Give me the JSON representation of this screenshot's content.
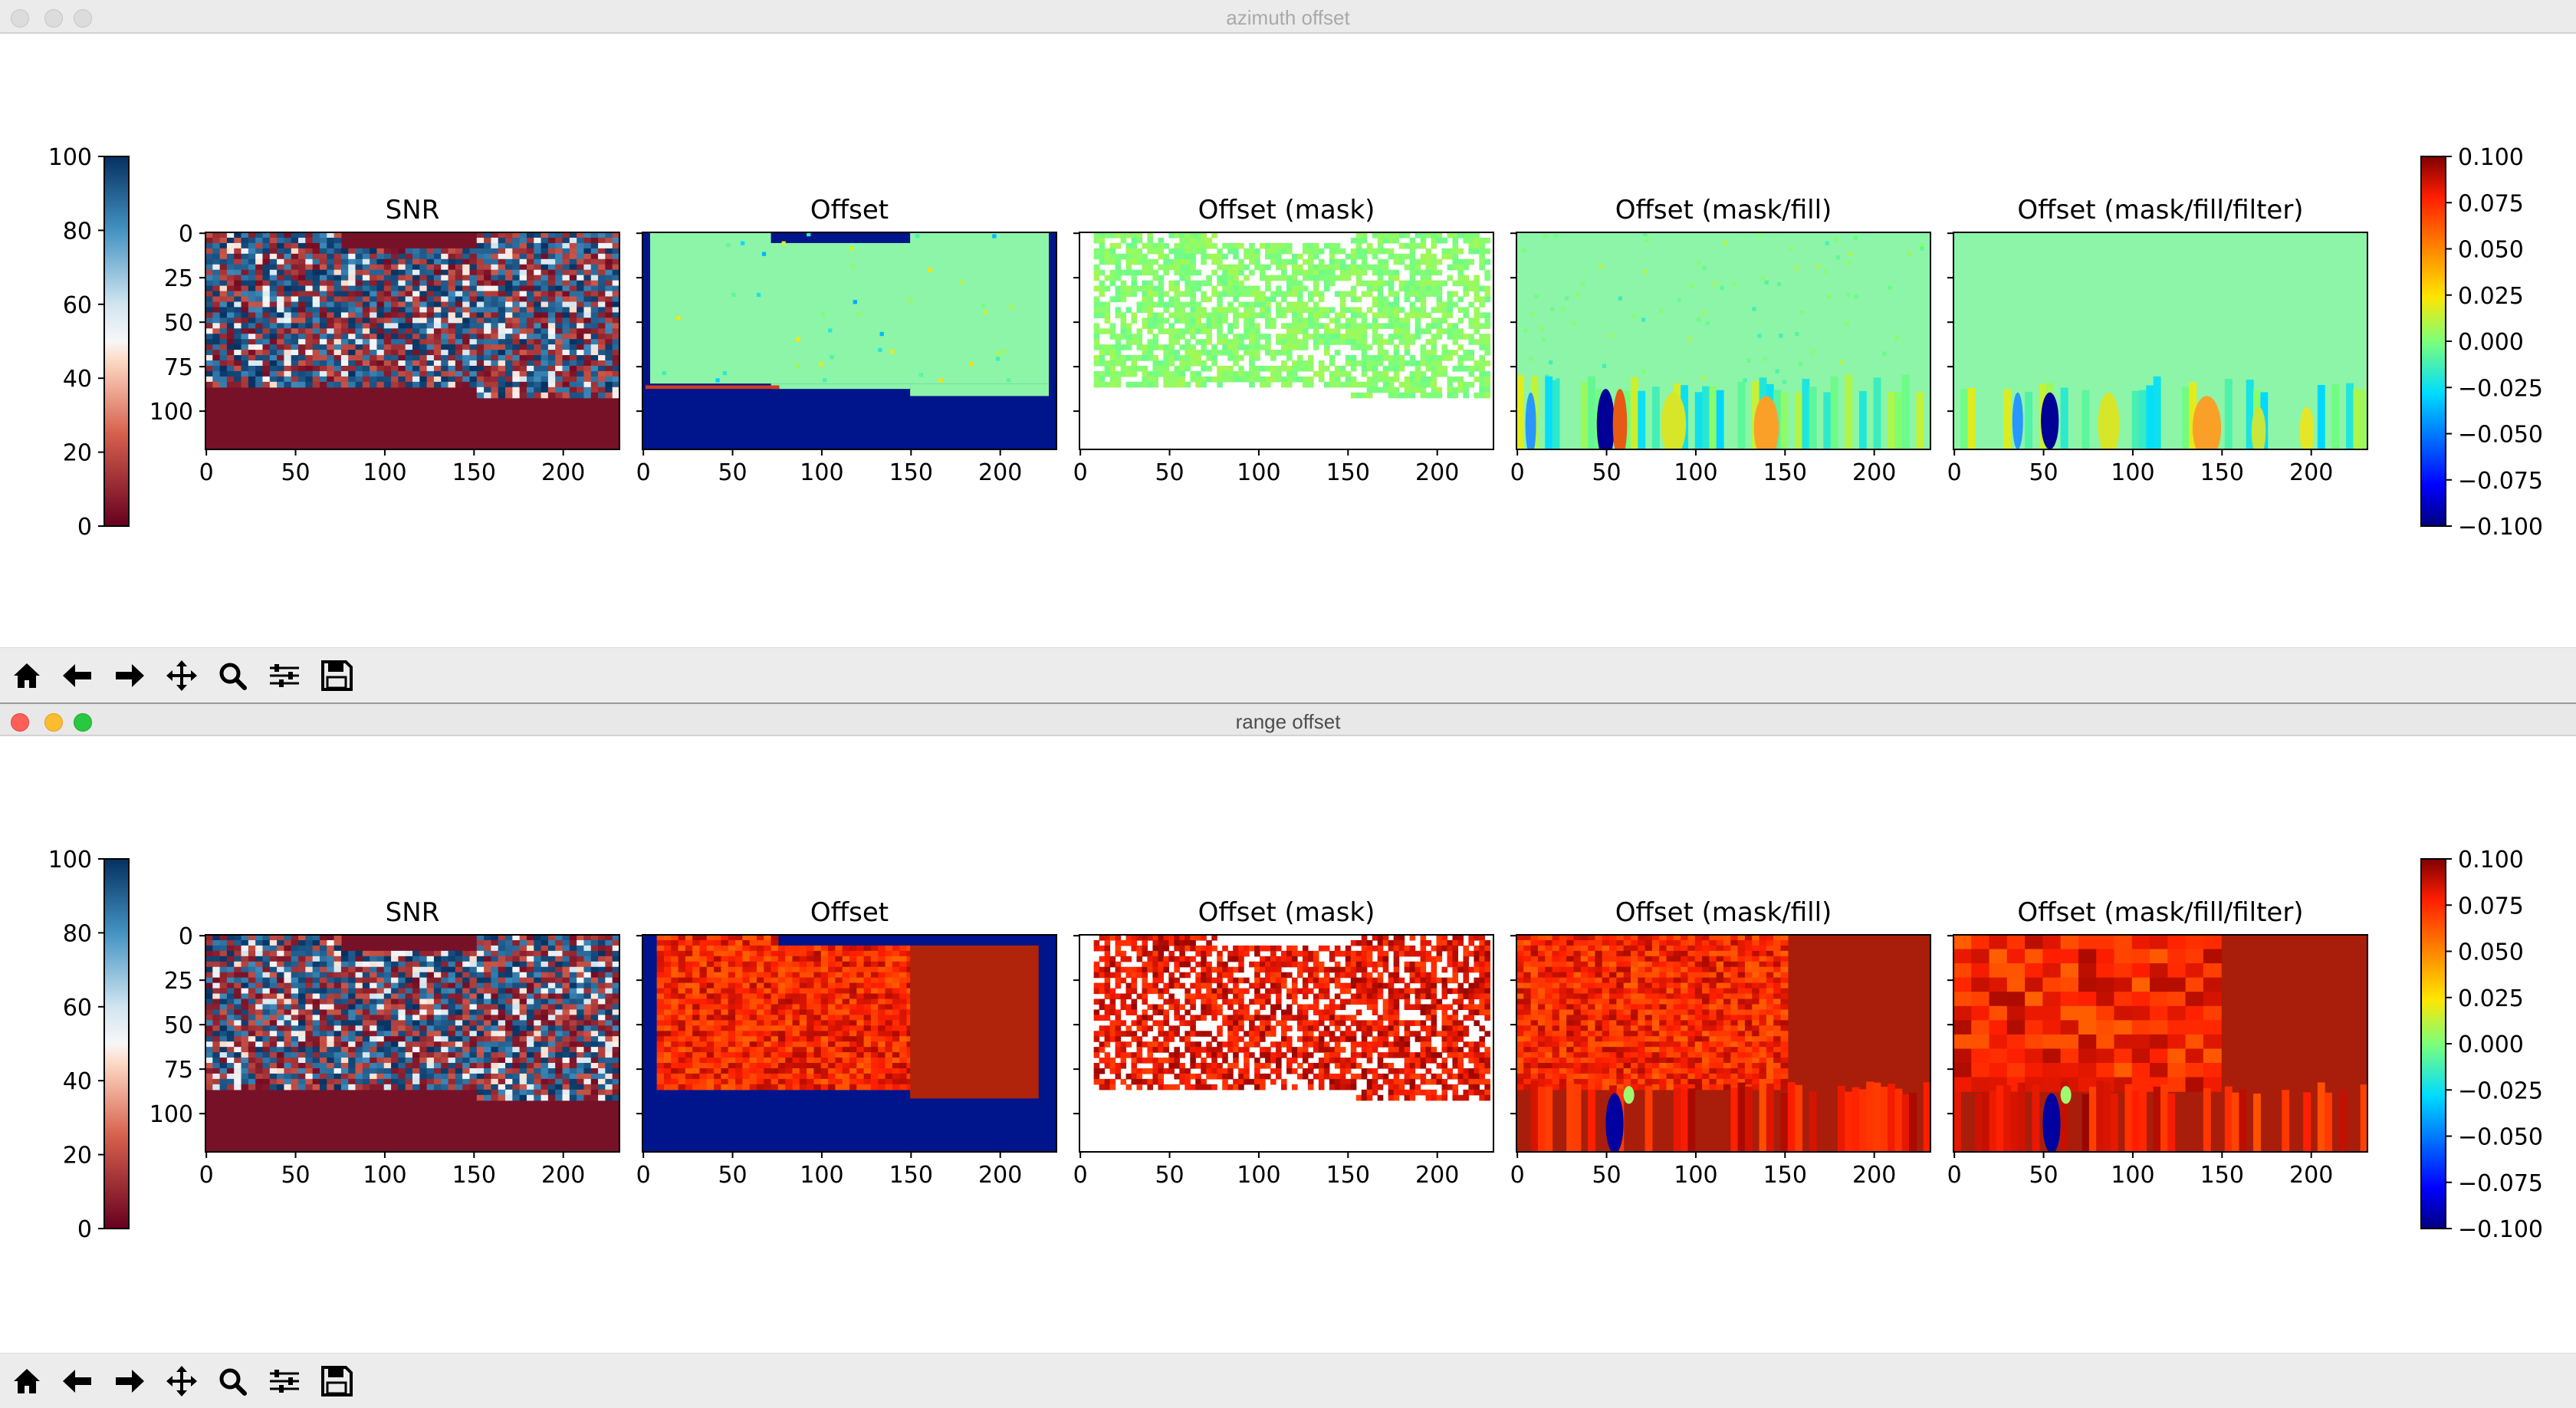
{
  "windows": [
    {
      "title": "azimuth offset",
      "state": "inactive",
      "figure": {
        "left_colorbar": {
          "label_ticks": [
            "100",
            "80",
            "60",
            "40",
            "20",
            "0"
          ],
          "colormap": "RdBu",
          "range": [
            0,
            100
          ]
        },
        "right_colorbar": {
          "label_ticks": [
            "0.100",
            "0.075",
            "0.050",
            "0.025",
            "0.000",
            "−0.025",
            "−0.050",
            "−0.075",
            "−0.100"
          ],
          "colormap": "jet",
          "range": [
            -0.1,
            0.1
          ]
        },
        "panels": [
          {
            "title": "SNR",
            "content": "snr"
          },
          {
            "title": "Offset",
            "content": "offset_az"
          },
          {
            "title": "Offset (mask)",
            "content": "mask_az"
          },
          {
            "title": "Offset (mask/fill)",
            "content": "fill_az"
          },
          {
            "title": "Offset (mask/fill/filter)",
            "content": "filter_az"
          }
        ],
        "x_ticks": [
          "0",
          "50",
          "100",
          "150",
          "200"
        ],
        "y_ticks": [
          "0",
          "25",
          "50",
          "75",
          "100"
        ]
      }
    },
    {
      "title": "range offset",
      "state": "active",
      "figure": {
        "left_colorbar": {
          "label_ticks": [
            "100",
            "80",
            "60",
            "40",
            "20",
            "0"
          ],
          "colormap": "RdBu",
          "range": [
            0,
            100
          ]
        },
        "right_colorbar": {
          "label_ticks": [
            "0.100",
            "0.075",
            "0.050",
            "0.025",
            "0.000",
            "−0.025",
            "−0.050",
            "−0.075",
            "−0.100"
          ],
          "colormap": "jet",
          "range": [
            -0.1,
            0.1
          ]
        },
        "panels": [
          {
            "title": "SNR",
            "content": "snr"
          },
          {
            "title": "Offset",
            "content": "offset_rg"
          },
          {
            "title": "Offset (mask)",
            "content": "mask_rg"
          },
          {
            "title": "Offset (mask/fill)",
            "content": "fill_rg"
          },
          {
            "title": "Offset (mask/fill/filter)",
            "content": "filter_rg"
          }
        ],
        "x_ticks": [
          "0",
          "50",
          "100",
          "150",
          "200"
        ],
        "y_ticks": [
          "0",
          "25",
          "50",
          "75",
          "100"
        ]
      }
    }
  ],
  "toolbar_buttons": [
    {
      "name": "home-button",
      "icon": "home-icon"
    },
    {
      "name": "back-button",
      "icon": "arrow-left-icon"
    },
    {
      "name": "forward-button",
      "icon": "arrow-right-icon"
    },
    {
      "name": "pan-button",
      "icon": "move-icon"
    },
    {
      "name": "zoom-button",
      "icon": "magnifier-icon"
    },
    {
      "name": "configure-subplots-button",
      "icon": "sliders-icon"
    },
    {
      "name": "save-button",
      "icon": "floppy-disk-icon"
    }
  ],
  "colors": {
    "snr_low": "#7b1a2a",
    "snr_high": "#1b4e8a",
    "jet_bg_cyan": "#8cf5a8",
    "jet_dark_blue": "#00108a",
    "jet_red": "#a01c10"
  }
}
